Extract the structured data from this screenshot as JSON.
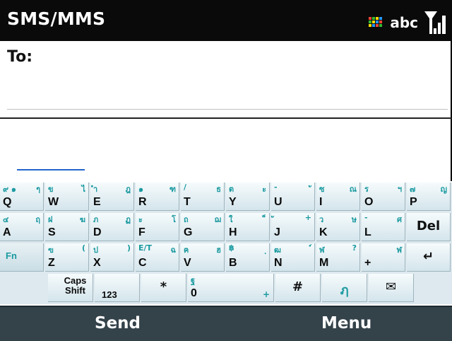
{
  "titlebar": {
    "title": "SMS/MMS",
    "input_mode": "abc",
    "icons": [
      "apps-icon",
      "signal-icon"
    ]
  },
  "compose": {
    "to_label": "To:"
  },
  "keyboard": {
    "row1": [
      {
        "lat": "Q",
        "tl": "๙ ๑",
        "tr": "ๆ"
      },
      {
        "lat": "W",
        "tl": "ข",
        "tr": "ไ"
      },
      {
        "lat": "E",
        "tl": "ำ",
        "tr": "ฎ"
      },
      {
        "lat": "R",
        "tl": "๑",
        "tr": "ฑ"
      },
      {
        "lat": "T",
        "tl": "/",
        "tr": "ธ"
      },
      {
        "lat": "Y",
        "tl": "ต",
        "tr": "ะ"
      },
      {
        "lat": "U",
        "tl": "-",
        "tr": "ั"
      },
      {
        "lat": "I",
        "tl": "ซ",
        "tr": "ณ"
      },
      {
        "lat": "O",
        "tl": "ร",
        "tr": "ฯ"
      },
      {
        "lat": "P",
        "tl": "๗",
        "tr": "ญ"
      }
    ],
    "row2": [
      {
        "lat": "A",
        "tl": "๔",
        "tr": "ฤ"
      },
      {
        "lat": "S",
        "tl": "ฝ",
        "tr": "ฆ"
      },
      {
        "lat": "D",
        "tl": "ภ",
        "tr": "ฏ"
      },
      {
        "lat": "F",
        "tl": "ะ",
        "tr": "โ"
      },
      {
        "lat": "G",
        "tl": "ถ",
        "tr": "ฌ"
      },
      {
        "lat": "H",
        "tl": "ใ",
        "tr": "็"
      },
      {
        "lat": "J",
        "tl": "ั",
        "tr": "+"
      },
      {
        "lat": "K",
        "tl": "ว",
        "tr": "ษ"
      },
      {
        "lat": "L",
        "tl": "-",
        "tr": "ศ"
      },
      {
        "lat": "Del",
        "tl": "",
        "tr": ""
      }
    ],
    "row3": [
      {
        "lat": "Fn",
        "tl": "",
        "tr": ""
      },
      {
        "lat": "Z",
        "tl": "ฃ",
        "tr": "("
      },
      {
        "lat": "X",
        "tl": "ป",
        "tr": ")"
      },
      {
        "lat": "C",
        "tl": "E/T",
        "tr": "ฉ"
      },
      {
        "lat": "V",
        "tl": "ฅ",
        "tr": "ฮ"
      },
      {
        "lat": "B",
        "tl": "฿",
        "tr": "ฺ"
      },
      {
        "lat": "N",
        "tl": "ฒ",
        "tr": "์"
      },
      {
        "lat": "M",
        "tl": "ฬ",
        "tr": "?"
      },
      {
        "lat": "+",
        "tl": "",
        "tr": "ฬ"
      },
      {
        "lat": "↵",
        "tl": "",
        "tr": ""
      }
    ],
    "row4": [
      {
        "lat": "Caps Shift"
      },
      {
        "lat": "123"
      },
      {
        "lat": "*"
      },
      {
        "lat": "0",
        "tl": "ฐ",
        "br": "+"
      },
      {
        "lat": "#"
      },
      {
        "lat": "ฦ",
        "tl": "ฦ"
      },
      {
        "lat": "✉"
      }
    ]
  },
  "softkeys": {
    "left": "Send",
    "right": "Menu"
  },
  "colors": {
    "titlebar": "#0a0a0a",
    "softbar": "#34424a",
    "thai_glyph": "#1a9aa0",
    "cursor": "#2266cc"
  }
}
